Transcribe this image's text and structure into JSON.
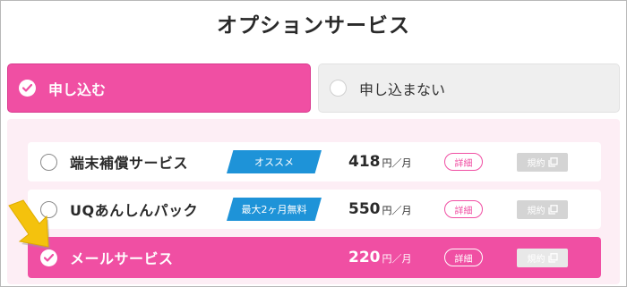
{
  "page": {
    "title": "オプションサービス"
  },
  "apply_options": [
    {
      "label": "申し込む",
      "selected": true
    },
    {
      "label": "申し込まない",
      "selected": false
    }
  ],
  "services": [
    {
      "name": "端末補償サービス",
      "badge": "オススメ",
      "price": "418",
      "unit": "円／月",
      "detail_label": "詳細",
      "terms_label": "規約",
      "selected": false
    },
    {
      "name": "UQあんしんパック",
      "badge": "最大2ヶ月無料",
      "price": "550",
      "unit": "円／月",
      "detail_label": "詳細",
      "terms_label": "規約",
      "selected": false
    },
    {
      "name": "メールサービス",
      "badge": "",
      "price": "220",
      "unit": "円／月",
      "detail_label": "詳細",
      "terms_label": "規約",
      "selected": true
    }
  ],
  "colors": {
    "accent": "#f04fa3",
    "badge": "#1e93d8",
    "panel": "#fdeef5",
    "arrow": "#f4c20d"
  },
  "icons": {
    "check": "check-icon",
    "external": "external-link-icon",
    "pointer": "pointer-arrow-icon"
  }
}
